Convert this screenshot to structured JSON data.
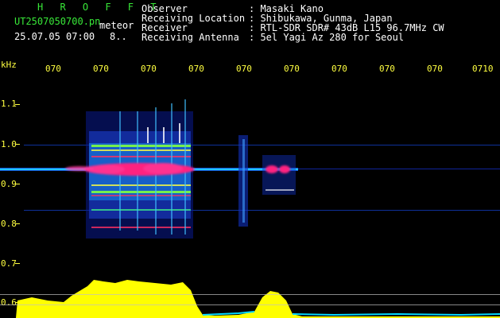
{
  "header": {
    "app_title": "H R O F F T",
    "file_name": "UT2507050700.pn",
    "meteor_tag": "meteor",
    "date_time": "25.07.05 07:00",
    "short_value": "8..",
    "labels": [
      "Observer",
      "Receiving Location",
      "Receiver",
      "Receiving Antenna"
    ],
    "values": [
      ": Masaki Kano",
      ": Shibukawa, Gunma, Japan",
      ": RTL-SDR SDR# 43dB L15 96.7MHz CW",
      ": 5el Yagi Az 280 for Seoul"
    ]
  },
  "time_axis": {
    "ticks": [
      "070",
      "070",
      "070",
      "070",
      "070",
      "070",
      "070",
      "070",
      "070",
      "0710"
    ]
  },
  "freq_axis": {
    "unit": "kHz",
    "ticks": [
      "1.1",
      "1.0",
      "0.9",
      "0.8",
      "0.7",
      "0.6"
    ]
  },
  "colors": {
    "background": "#000000",
    "axis_text": "#ffff40",
    "header_text": "#ffffff",
    "filename_text": "#38e838",
    "echo_core": "#ff2080",
    "amplitude_fill": "#ffff00",
    "noise_floor": "#00d8ff"
  }
}
